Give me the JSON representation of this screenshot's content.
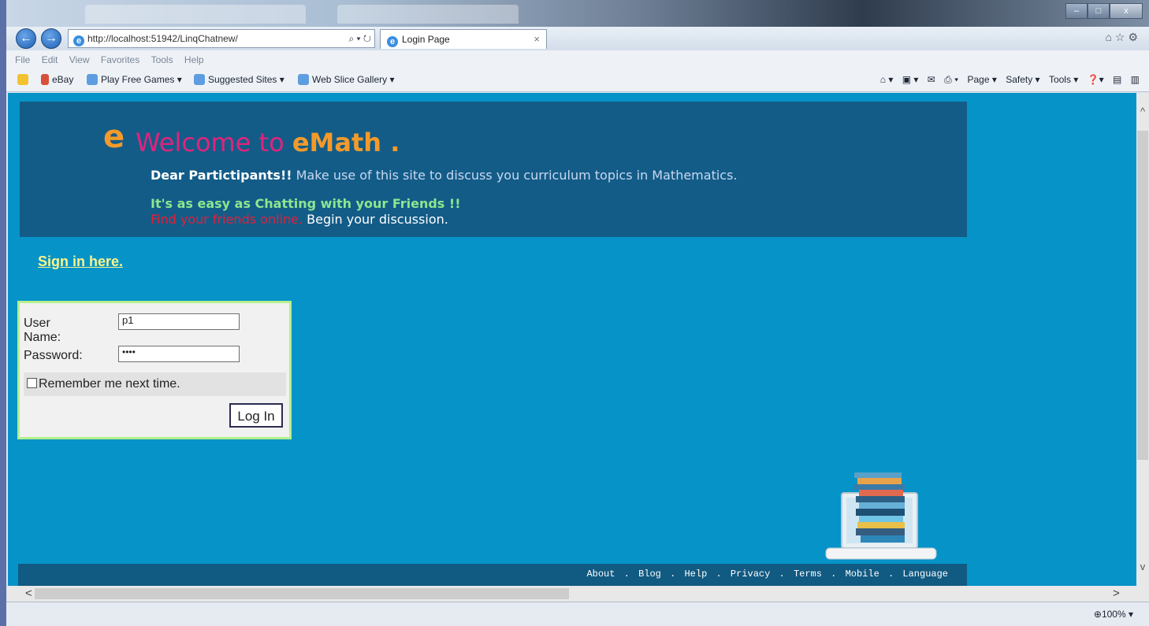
{
  "browser": {
    "address_url": "http://localhost:51942/LinqChatnew/",
    "tab_title": "Login Page",
    "tab_close": "×",
    "back_icon": "←",
    "forward_icon": "→",
    "menu": [
      "File",
      "Edit",
      "View",
      "Favorites",
      "Tools",
      "Help"
    ],
    "favorites": [
      "eBay",
      "Play Free Games ▾",
      "Suggested Sites ▾",
      "Web Slice Gallery ▾"
    ],
    "command_bar": [
      "Page ▾",
      "Safety ▾",
      "Tools ▾"
    ],
    "zoom": "100%",
    "window_controls": [
      "–",
      "□",
      "x"
    ]
  },
  "header": {
    "logo_letter": "e",
    "welcome_prefix": "Welcome to ",
    "welcome_brand": "eMath .",
    "dear_label": "Dear Partictipants!!",
    "dear_text": " Make use of this site to discuss you curriculum topics in Mathematics.",
    "easy_text": "It's as easy as Chatting with your Friends !!",
    "find_text": "Find your friends online.",
    "begin_text": " Begin your discussion."
  },
  "signin_link": "Sign in here.",
  "login": {
    "username_label": "User Name:",
    "username_value": "p1",
    "password_label": "Password:",
    "password_value": "••••",
    "remember_label": "Remember me next time.",
    "login_button": "Log In"
  },
  "footer": {
    "links": [
      "About",
      "Blog",
      "Help",
      "Privacy",
      "Terms",
      "Mobile",
      "Language"
    ],
    "separator": "."
  },
  "colors": {
    "page_bg": "#0693c8",
    "header_bg": "#135c88",
    "welcome_pink": "#e0247c",
    "brand_orange": "#f39a2a",
    "easy_green": "#8ee68e",
    "find_red": "#e0203a",
    "signin_yellow": "#f7f58a",
    "login_border": "#b6f08c"
  }
}
